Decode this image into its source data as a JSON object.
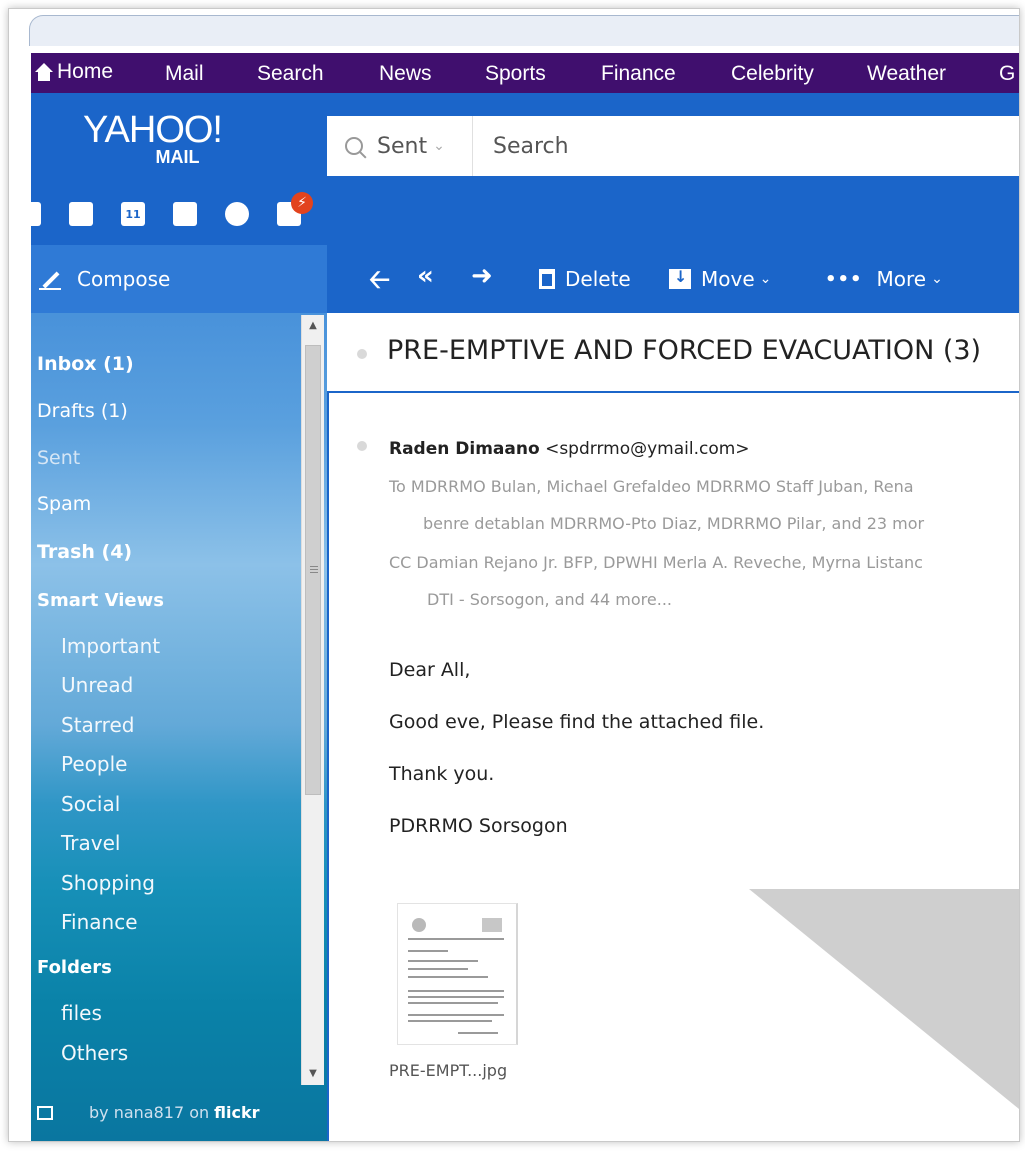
{
  "topnav": {
    "items": [
      "Home",
      "Mail",
      "Search",
      "News",
      "Sports",
      "Finance",
      "Celebrity",
      "Weather",
      "G"
    ]
  },
  "logo": {
    "main": "YAHOO!",
    "sub": "MAIL"
  },
  "search": {
    "scope": "Sent",
    "placeholder": "Search"
  },
  "apps": {
    "calendar_day": "11",
    "icons": [
      "mail-icon",
      "contacts-icon",
      "calendar-icon",
      "notepad-icon",
      "messenger-icon",
      "newsfeed-icon"
    ],
    "badge_icon": "lightning-icon"
  },
  "compose": {
    "label": "Compose"
  },
  "toolbar": {
    "delete": "Delete",
    "move": "Move",
    "more": "More"
  },
  "sidebar": {
    "folders": [
      {
        "label": "Inbox (1)",
        "bold": true
      },
      {
        "label": "Drafts (1)",
        "bold": false
      },
      {
        "label": "Sent",
        "bold": false
      },
      {
        "label": "Spam",
        "bold": false
      },
      {
        "label": "Trash (4)",
        "bold": true
      }
    ],
    "smart_views_title": "Smart Views",
    "smart_views": [
      "Important",
      "Unread",
      "Starred",
      "People",
      "Social",
      "Travel",
      "Shopping",
      "Finance"
    ],
    "folders_title": "Folders",
    "user_folders": [
      "files",
      "Others"
    ],
    "credit_prefix": "by nana817 on",
    "credit_brand": "flickr"
  },
  "message": {
    "subject": "PRE-EMPTIVE AND FORCED EVACUATION (3)",
    "sender_name": "Raden Dimaano",
    "sender_email": "<spdrrmo@ymail.com>",
    "to_line1": "To  MDRRMO Bulan, Michael Grefaldeo MDRRMO Staff Juban, Rena",
    "to_line2": "benre detablan MDRRMO-Pto Diaz, MDRRMO Pilar, and 23 mor",
    "cc_line1": "CC  Damian Rejano Jr. BFP, DPWHI Merla A. Reveche, Myrna Listanc",
    "cc_line2": "DTI - Sorsogon, and 44 more...",
    "body": [
      "Dear All,",
      "Good eve, Please find the attached file.",
      "Thank you.",
      "PDRRMO Sorsogon"
    ],
    "attachment_name": "PRE-EMPT...jpg"
  },
  "colors": {
    "nav_purple": "#400f6e",
    "yahoo_blue": "#1b65c9",
    "compose_blue": "#2f7ad6",
    "badge_red": "#e2431e"
  }
}
